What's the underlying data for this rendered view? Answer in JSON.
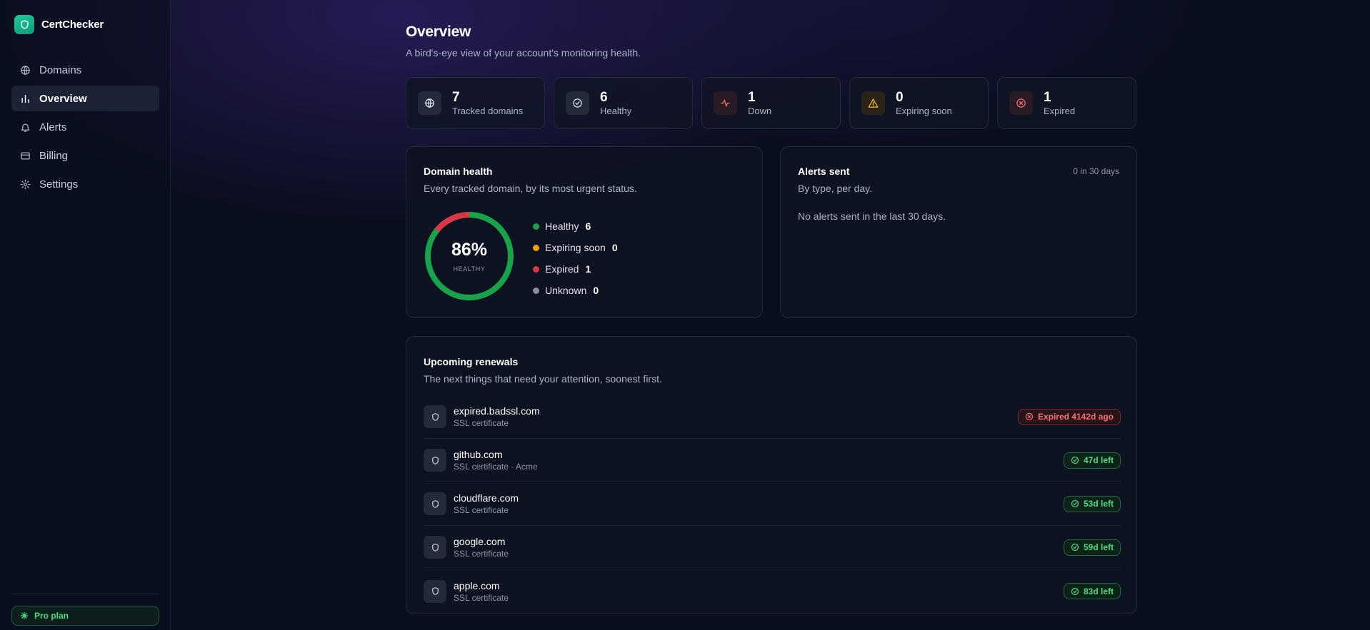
{
  "app": {
    "name": "CertChecker"
  },
  "sidebar": {
    "items": [
      {
        "label": "Domains",
        "icon": "globe-icon"
      },
      {
        "label": "Overview",
        "icon": "bar-chart-icon",
        "active": true
      },
      {
        "label": "Alerts",
        "icon": "bell-icon"
      },
      {
        "label": "Billing",
        "icon": "credit-card-icon"
      },
      {
        "label": "Settings",
        "icon": "gear-icon"
      }
    ],
    "plan": "Pro plan"
  },
  "header": {
    "title": "Overview",
    "subtitle": "A bird's-eye view of your account's monitoring health."
  },
  "stats": [
    {
      "value": "7",
      "label": "Tracked domains",
      "icon": "globe-icon"
    },
    {
      "value": "6",
      "label": "Healthy",
      "icon": "check-circle-icon"
    },
    {
      "value": "1",
      "label": "Down",
      "icon": "activity-icon"
    },
    {
      "value": "0",
      "label": "Expiring soon",
      "icon": "warning-icon"
    },
    {
      "value": "1",
      "label": "Expired",
      "icon": "x-circle-icon"
    }
  ],
  "domain_health": {
    "title": "Domain health",
    "subtitle": "Every tracked domain, by its most urgent status.",
    "percent": "86%",
    "percent_label": "HEALTHY",
    "legend": [
      {
        "label": "Healthy",
        "count": "6",
        "color": "#16a34a"
      },
      {
        "label": "Expiring soon",
        "count": "0",
        "color": "#f59e0b"
      },
      {
        "label": "Expired",
        "count": "1",
        "color": "#dc3545"
      },
      {
        "label": "Unknown",
        "count": "0",
        "color": "#8b8f99"
      }
    ]
  },
  "alerts_sent": {
    "title": "Alerts sent",
    "subtitle": "By type, per day.",
    "meta": "0 in 30 days",
    "empty": "No alerts sent in the last 30 days."
  },
  "renewals": {
    "title": "Upcoming renewals",
    "subtitle": "The next things that need your attention, soonest first.",
    "items": [
      {
        "domain": "expired.badssl.com",
        "meta": "SSL certificate",
        "status": "Expired 4142d ago",
        "tone": "red"
      },
      {
        "domain": "github.com",
        "meta": "SSL certificate · Acme",
        "status": "47d left",
        "tone": "green"
      },
      {
        "domain": "cloudflare.com",
        "meta": "SSL certificate",
        "status": "53d left",
        "tone": "green"
      },
      {
        "domain": "google.com",
        "meta": "SSL certificate",
        "status": "59d left",
        "tone": "green"
      },
      {
        "domain": "apple.com",
        "meta": "SSL certificate",
        "status": "83d left",
        "tone": "green"
      }
    ]
  }
}
